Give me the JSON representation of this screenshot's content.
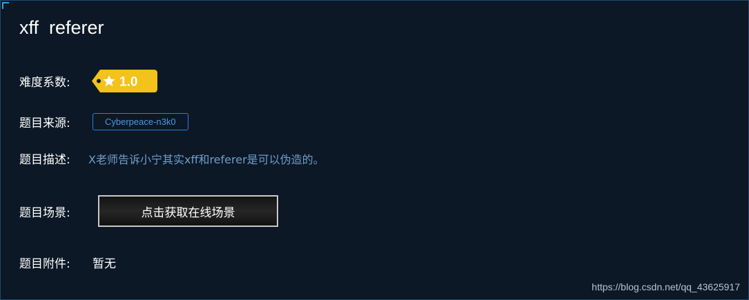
{
  "challenge": {
    "title": "xff  referer",
    "difficulty_label": "难度系数:",
    "difficulty_value": "1.0",
    "source_label": "题目来源:",
    "source_value": "Cyberpeace-n3k0",
    "description_label": "题目描述:",
    "description_value": "X老师告诉小宁其实xff和referer是可以伪造的。",
    "scene_label": "题目场景:",
    "scene_button": "点击获取在线场景",
    "attachment_label": "题目附件:",
    "attachment_value": "暂无"
  },
  "watermark": "https://blog.csdn.net/qq_43625917",
  "colors": {
    "background": "#0c1826",
    "difficulty_tag": "#f3c21b",
    "source_border": "#2f7fd4",
    "description_text": "#6f9ec9",
    "corner_accent": "#19a8e8"
  },
  "icons": {
    "difficulty": "star-icon"
  }
}
